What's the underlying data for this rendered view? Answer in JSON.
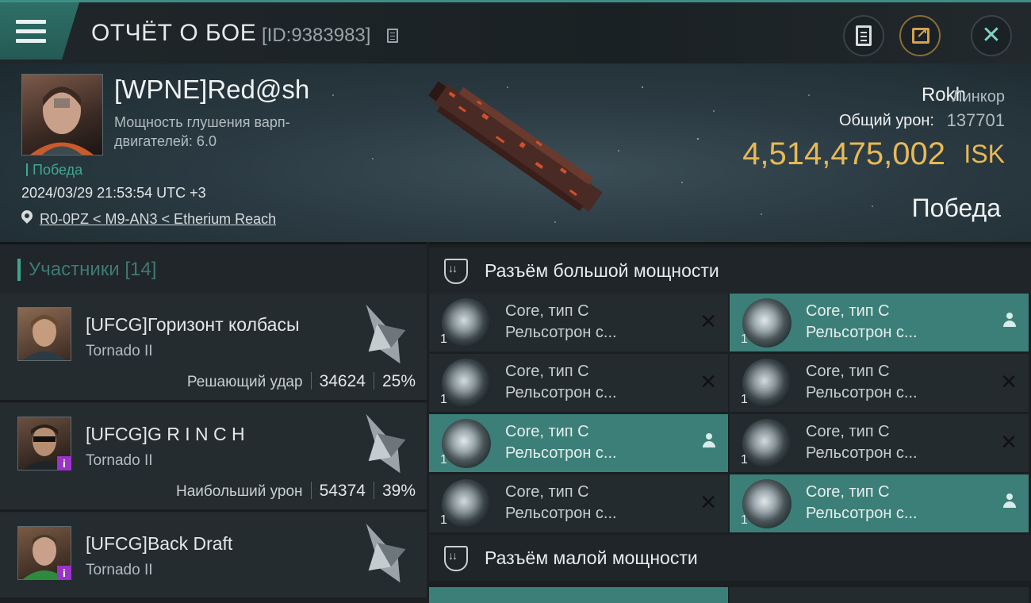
{
  "header": {
    "title": "ОТЧЁТ О БОЕ",
    "report_id": "[ID:9383983]",
    "icons": [
      "menu-icon",
      "copy-icon",
      "clipboard-icon",
      "share-icon",
      "close-icon"
    ]
  },
  "victim": {
    "pilot_name": "[WPNE]Red@sh",
    "warp_jam_label": "Мощность глушения варп-двигателей: 6.0",
    "status_tag": "Победа",
    "datetime": "2024/03/29 21:53:54 UTC +3",
    "location": "R0-0PZ < M9-AN3 < Etherium Reach",
    "ship_name": "Rokh",
    "ship_class": "Линкор",
    "total_damage_label": "Общий урон:",
    "total_damage_value": "137701",
    "isk_value": "4,514,475,002",
    "isk_unit": "ISK",
    "result": "Победа"
  },
  "participants": {
    "title": "Участники [14]",
    "items": [
      {
        "name": "[UFCG]Горизонт колбасы",
        "ship": "Tornado II",
        "stat_label": "Решающий удар",
        "damage": "34624",
        "percent": "25%",
        "badge": ""
      },
      {
        "name": "[UFCG]G R I N C H",
        "ship": "Tornado II",
        "stat_label": "Наибольший урон",
        "damage": "54374",
        "percent": "39%",
        "badge": "i"
      },
      {
        "name": "[UFCG]Back Draft",
        "ship": "Tornado II",
        "stat_label": "",
        "damage": "",
        "percent": "",
        "badge": "i"
      }
    ]
  },
  "fittings": {
    "high_slot_title": "Разъём большой мощности",
    "low_slot_title": "Разъём малой мощности",
    "modules": [
      {
        "line1": "Core, тип C",
        "line2": "Рельсотрон с...",
        "qty": "1",
        "state": "destroyed"
      },
      {
        "line1": "Core, тип C",
        "line2": "Рельсотрон с...",
        "qty": "1",
        "state": "dropped"
      },
      {
        "line1": "Core, тип C",
        "line2": "Рельсотрон с...",
        "qty": "1",
        "state": "destroyed"
      },
      {
        "line1": "Core, тип C",
        "line2": "Рельсотрон с...",
        "qty": "1",
        "state": "destroyed"
      },
      {
        "line1": "Core, тип C",
        "line2": "Рельсотрон с...",
        "qty": "1",
        "state": "dropped"
      },
      {
        "line1": "Core, тип C",
        "line2": "Рельсотрон с...",
        "qty": "1",
        "state": "destroyed"
      },
      {
        "line1": "Core, тип C",
        "line2": "Рельсотрон с...",
        "qty": "1",
        "state": "destroyed"
      },
      {
        "line1": "Core, тип C",
        "line2": "Рельсотрон с...",
        "qty": "1",
        "state": "dropped"
      }
    ]
  },
  "colors": {
    "accent": "#3d8f86",
    "isk_gold": "#e8b955",
    "win_green": "#3fa78f",
    "badge_purple": "#9a33c7"
  }
}
